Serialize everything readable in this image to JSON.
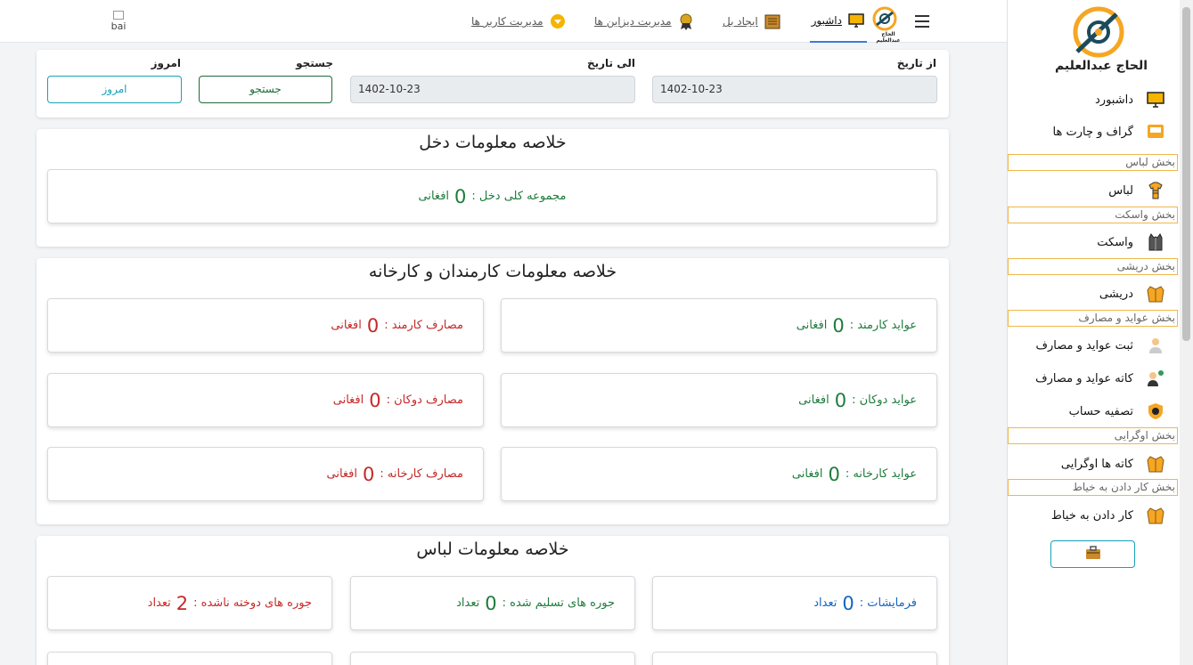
{
  "topnav": {
    "items": [
      {
        "label": "داشبور",
        "active": true
      },
      {
        "label": "ایجاد بل",
        "active": false
      },
      {
        "label": "مدیریت دیزاین ها",
        "active": false
      },
      {
        "label": "مدیریت کاربر ها",
        "active": false
      }
    ],
    "logo_text": "الحاج عبدالعلیم",
    "broken_image_alt": "bai"
  },
  "filter": {
    "from_label": "از تاریخ",
    "from_value": "1402-10-23",
    "to_label": "الی تاریخ",
    "to_value": "1402-10-23",
    "search_label": "جستجو",
    "search_button": "جستجو",
    "today_label": "امروز",
    "today_button": "امروز"
  },
  "income_summary": {
    "title": "خلاصه معلومات دخل",
    "total_label": "مجموعه کلی دخل :",
    "total_value": "0",
    "currency": "افغانی"
  },
  "staff_summary": {
    "title": "خلاصه معلومات کارمندان و کارخانه",
    "cards": [
      {
        "label": "عواید کارمند :",
        "value": "0",
        "unit": "افغانی",
        "color": "#1e7b3c"
      },
      {
        "label": "مصارف کارمند :",
        "value": "0",
        "unit": "افغانی",
        "color": "#c62828"
      },
      {
        "label": "عواید دوکان :",
        "value": "0",
        "unit": "افغانی",
        "color": "#1e7b3c"
      },
      {
        "label": "مصارف دوکان :",
        "value": "0",
        "unit": "افغانی",
        "color": "#c62828"
      },
      {
        "label": "عواید کارخانه :",
        "value": "0",
        "unit": "افغانی",
        "color": "#1e7b3c"
      },
      {
        "label": "مصارف کارخانه :",
        "value": "0",
        "unit": "افغانی",
        "color": "#c62828"
      }
    ]
  },
  "clothes_summary": {
    "title": "خلاصه معلومات لباس",
    "cards": [
      {
        "label": "فرمایشات :",
        "value": "0",
        "unit": "تعداد",
        "color": "#1565c0"
      },
      {
        "label": "جوره های تسلیم شده :",
        "value": "0",
        "unit": "تعداد",
        "color": "#1e7b3c"
      },
      {
        "label": "جوره های دوخته ناشده :",
        "value": "2",
        "unit": "تعداد",
        "color": "#c62828"
      }
    ]
  },
  "sidebar": {
    "brand": "الحاج عبدالعلیم",
    "items": [
      {
        "label": "داشبورد",
        "icon": "monitor-icon"
      },
      {
        "label": "گراف و چارت ها",
        "icon": "chart-icon"
      },
      {
        "label": "لباس",
        "icon": "shirt-icon"
      },
      {
        "label": "واسکت",
        "icon": "vest-icon"
      },
      {
        "label": "دریشی",
        "icon": "suit-icon"
      },
      {
        "label": "ثبت عواید و مصارف",
        "icon": "person-icon"
      },
      {
        "label": "کاته عواید و مصارف",
        "icon": "people-icon"
      },
      {
        "label": "تصفیه حساب",
        "icon": "shield-icon"
      },
      {
        "label": "کاته ها اوگرایی",
        "icon": "suit-icon"
      },
      {
        "label": "کار دادن به خیاط",
        "icon": "suit-icon"
      }
    ],
    "sections": [
      "بخش لباس",
      "بخش واسکت",
      "بخش دریشی",
      "بخش عواید و مصارف",
      "بخش اوگرایی",
      "بخش کار دادن به خیاط"
    ],
    "accent": "#f0b74a"
  }
}
